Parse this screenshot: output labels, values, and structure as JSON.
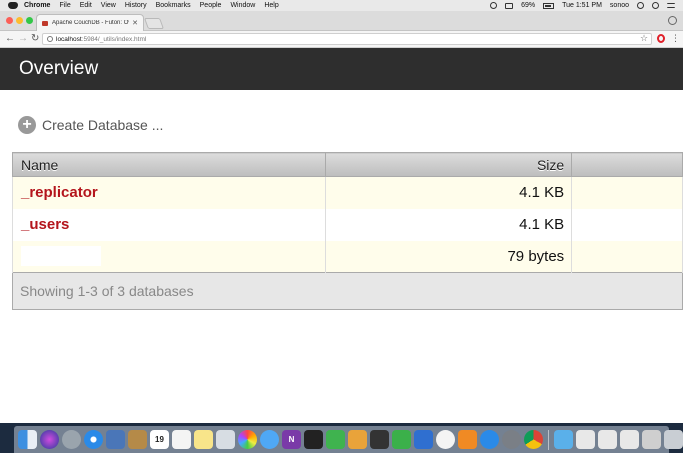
{
  "menubar": {
    "items": [
      "Chrome",
      "File",
      "Edit",
      "View",
      "History",
      "Bookmarks",
      "People",
      "Window",
      "Help"
    ],
    "battery": "69%",
    "clock": "Tue 1:51 PM",
    "user": "sonoo"
  },
  "browser": {
    "tab_title": "Apache CouchDB - Futon: Ove",
    "tab_close": "✕",
    "url_host": "localhost",
    "url_path": ":5984/_utils/index.html",
    "star": "☆",
    "kebab": "⋮"
  },
  "page": {
    "title": "Overview",
    "create_database_label": "Create Database ...",
    "table": {
      "headers": {
        "name": "Name",
        "size": "Size"
      },
      "rows": [
        {
          "name": "_replicator",
          "size": "4.1 KB"
        },
        {
          "name": "_users",
          "size": "4.1 KB"
        },
        {
          "name": "",
          "size": "79 bytes"
        }
      ],
      "footer": "Showing 1-3 of 3 databases"
    }
  },
  "dock": {
    "icons": [
      "finder-icon",
      "siri-icon",
      "launchpad-icon",
      "safari-icon",
      "photo-icon",
      "contacts-icon",
      "calendar-icon",
      "reminders-icon",
      "notes-icon",
      "preview-icon",
      "photos-icon",
      "messages-icon",
      "onenote-icon",
      "terminal-icon",
      "facetime-icon",
      "pages-icon",
      "go-icon",
      "numbers-icon",
      "keynote-icon",
      "itunes-icon",
      "ibooks-icon",
      "appstore-icon",
      "preferences-icon",
      "chrome-icon",
      "folder-icon",
      "screenshot-icon",
      "screenshot-icon-2",
      "screenshot-icon-3",
      "screenshot-icon-4",
      "trash-icon"
    ],
    "calendar_day": "19"
  }
}
